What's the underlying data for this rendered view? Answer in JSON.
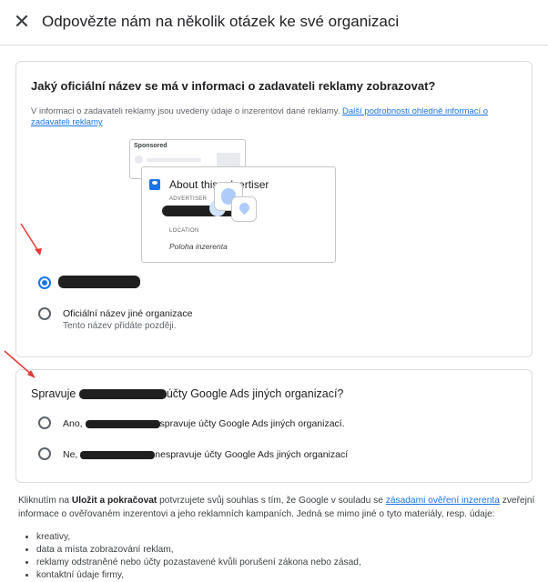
{
  "header": {
    "close_icon": "close-icon",
    "title": "Odpovězte nám na několik otázek ke své organizaci"
  },
  "question1": {
    "title": "Jaký oficiální název se má v informaci o zadavateli reklamy zobrazovat?",
    "description": "V informaci o zadavateli reklamy jsou uvedeny údaje o inzerentovi dané reklamy. ",
    "link": "Další podrobnosti ohledně informací o zadavateli reklamy",
    "illustration": {
      "sponsored": "Sponsored",
      "about_title": "About this advertiser",
      "advertiser_label": "ADVERTISER",
      "location_label": "LOCATION",
      "location_value": "Poloha inzerenta"
    },
    "options": [
      {
        "label": "",
        "selected": true,
        "redacted": true
      },
      {
        "label": "Oficiální název jiné organizace",
        "sub": "Tento název přidáte později.",
        "selected": false
      }
    ]
  },
  "question2": {
    "title_prefix": "Spravuje ",
    "title_suffix": "účty Google Ads jiných organizací?",
    "options": [
      {
        "prefix": "Ano, ",
        "suffix": "spravuje účty Google Ads jiných organizací.",
        "selected": false
      },
      {
        "prefix": "Ne, ",
        "suffix": "nespravuje účty Google Ads jiných organizací",
        "selected": false
      }
    ]
  },
  "footer": {
    "text_start": "Kliknutím na ",
    "bold": "Uložit a pokračovat",
    "text_mid": " potvrzujete svůj souhlas s tím, že Google v souladu se ",
    "link": "zásadami ověření inzerenta",
    "text_end": " zveřejní informace o ověřovaném inzerentovi a jeho reklamních kampaních. Jedná se mimo jiné o tyto materiály, resp. údaje:",
    "bullets": [
      "kreativy,",
      "data a místa zobrazování reklam,",
      "reklamy odstraněné nebo účty pozastavené kvůli porušení zákona nebo zásad,",
      "kontaktní údaje firmy,"
    ]
  },
  "colors": {
    "accent": "#1a73e8",
    "arrow": "#e53935"
  }
}
